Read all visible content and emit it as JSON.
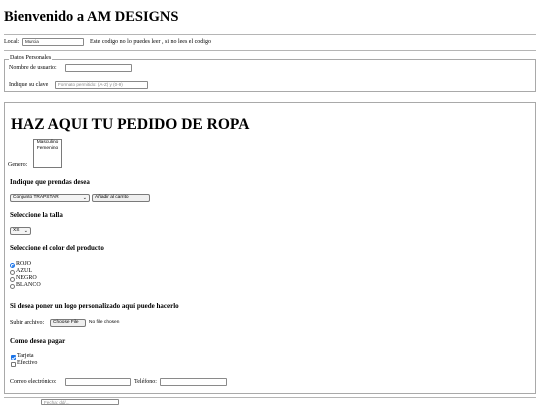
{
  "header": {
    "title": "Bienvenido a AM DESIGNS"
  },
  "local": {
    "label": "Local:",
    "value": "Murcia",
    "note": "Este codigo no lo puedes leer , si no lees el codigo"
  },
  "personal": {
    "legend": "Datos Personales",
    "username_label": "Nombre de usuario:",
    "username_value": "",
    "password_label": "Indique su clave",
    "password_placeholder": "Formato permitido: (A-Z) y (0-9)"
  },
  "order": {
    "title": "HAZ AQUI TU PEDIDO DE ROPA",
    "gender_label": "Genero:",
    "gender_options": [
      "Masculino",
      "Femenino"
    ],
    "garments_heading": "Indique que prendas desea",
    "garment_selected": "Conjunto TRAPSTAR",
    "add_to_cart": "Añadir al carrito",
    "size_heading": "Seleccione la talla",
    "size_selected": "XS",
    "color_heading": "Seleccione el color del producto",
    "colors": [
      {
        "label": "ROJO",
        "checked": true
      },
      {
        "label": "AZUL",
        "checked": false
      },
      {
        "label": "NEGRO",
        "checked": false
      },
      {
        "label": "BLANCO",
        "checked": false
      }
    ],
    "logo_heading": "Si desea poner un logo personalizado aquí puede hacerlo",
    "upload_label": "Subir archivo:",
    "choose_file": "Choose File",
    "no_file": "No file chosen",
    "payment_heading": "Como desea pagar",
    "payments": [
      {
        "label": "Tarjeta",
        "checked": true
      },
      {
        "label": "Efectivo",
        "checked": false
      }
    ],
    "email_label": "Correo electrónico:",
    "email_value": "",
    "phone_label": "Teléfono:",
    "phone_value": ""
  },
  "footer": {
    "date_placeholder": "Fecha: dd/..."
  },
  "colors": {
    "accent": "#1a73e8",
    "border": "#a9a9a9"
  }
}
